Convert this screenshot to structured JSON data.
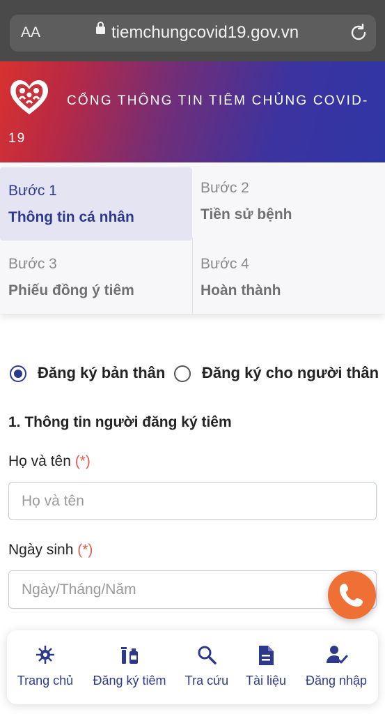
{
  "browser": {
    "aa_label": "AA",
    "url": "tiemchungcovid19.gov.vn"
  },
  "banner": {
    "title_line1": "CỔNG THÔNG TIN TIÊM CHỦNG COVID-",
    "title_line2": "19",
    "colors": {
      "start": "#d8322f",
      "end": "#2f36a4"
    }
  },
  "steps": [
    {
      "number": "Bước 1",
      "title": "Thông tin cá nhân",
      "active": true
    },
    {
      "number": "Bước 2",
      "title": "Tiền sử bệnh",
      "active": false
    },
    {
      "number": "Bước 3",
      "title": "Phiếu đồng ý tiêm",
      "active": false
    },
    {
      "number": "Bước 4",
      "title": "Hoàn thành",
      "active": false
    }
  ],
  "registration_type": {
    "options": [
      "Đăng ký bản thân",
      "Đăng ký cho người thân"
    ],
    "selected": "Đăng ký bản thân"
  },
  "form": {
    "section_title": "1. Thông tin người đăng ký tiêm",
    "required_marker": "(*)",
    "fields": [
      {
        "label": "Họ và tên",
        "placeholder": "Họ và tên",
        "value": ""
      },
      {
        "label": "Ngày sinh",
        "placeholder": "Ngày/Tháng/Năm",
        "value": ""
      }
    ]
  },
  "call_button": {
    "icon": "phone-icon",
    "color": "#ee7034"
  },
  "bottom_nav": [
    {
      "label": "Trang chủ",
      "icon": "virus-icon"
    },
    {
      "label": "Đăng ký tiêm",
      "icon": "vaccine-icon"
    },
    {
      "label": "Tra cứu",
      "icon": "search-icon"
    },
    {
      "label": "Tài liệu",
      "icon": "document-icon"
    },
    {
      "label": "Đăng nhập",
      "icon": "user-check-icon"
    }
  ],
  "accent_color": "#2d3a8c"
}
